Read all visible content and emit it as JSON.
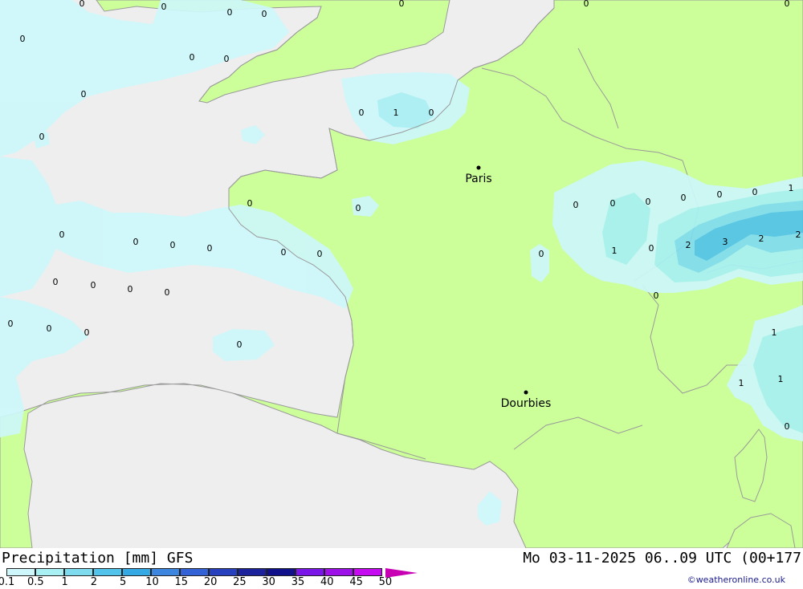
{
  "map": {
    "colors": {
      "sea": "#eeeeee",
      "land": "#ccff99",
      "precip_light": "#cdf7fa",
      "precip_1": "#a8f0f4",
      "precip_2": "#7fdcef",
      "precip_5": "#52c3ea"
    },
    "cities": [
      {
        "name": "Paris"
      },
      {
        "name": "Dourbies"
      }
    ],
    "value_labels": [
      "0",
      "0",
      "0",
      "0",
      "0",
      "0",
      "0",
      "0",
      "0",
      "0",
      "1",
      "0",
      "0",
      "0",
      "0",
      "0",
      "0",
      "0",
      "0",
      "0",
      "0",
      "0",
      "0",
      "0",
      "0",
      "0",
      "0",
      "0",
      "0",
      "0",
      "0",
      "0",
      "0",
      "0",
      "0",
      "1",
      "0",
      "0",
      "0",
      "0",
      "1",
      "2",
      "3",
      "2",
      "2",
      "0",
      "1",
      "1",
      "1",
      "0"
    ]
  },
  "footer": {
    "title": "Precipitation [mm] GFS",
    "time": "Mo 03-11-2025 06..09 UTC (00+177",
    "credit": "©weatheronline.co.uk",
    "legend": {
      "colors": [
        "#cdf7fa",
        "#a8f0f4",
        "#7fdcef",
        "#52c3ea",
        "#35a9e3",
        "#3d86e0",
        "#3361d6",
        "#2740bd",
        "#1b229c",
        "#10108a",
        "#7b16e8",
        "#9e10e8",
        "#c509f0",
        "#e800e8",
        "#c800b4"
      ],
      "ticks": [
        "0.1",
        "0.5",
        "1",
        "2",
        "5",
        "10",
        "15",
        "20",
        "25",
        "30",
        "35",
        "40",
        "45",
        "50"
      ]
    }
  }
}
